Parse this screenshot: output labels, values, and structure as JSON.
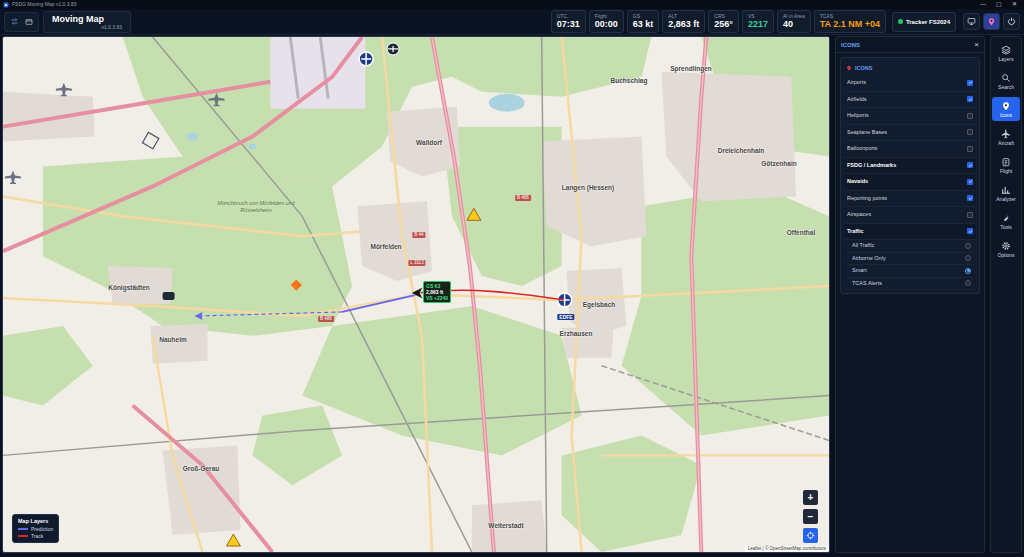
{
  "window": {
    "title": "FSDG Moving Map v1.0.3.83",
    "controls": [
      "—",
      "▢",
      "✕"
    ]
  },
  "header": {
    "title": "Moving Map",
    "version": "v1.0.3.83",
    "stats": [
      {
        "label": "UTC",
        "value": "07:31",
        "color": "#ffffff"
      },
      {
        "label": "Flight",
        "value": "00:00",
        "color": "#ffffff"
      },
      {
        "label": "GS",
        "value": "63 kt",
        "color": "#ffffff"
      },
      {
        "label": "ALT",
        "value": "2,863 ft",
        "color": "#ffffff"
      },
      {
        "label": "CRS",
        "value": "256°",
        "color": "#ffffff"
      },
      {
        "label": "VS",
        "value": "2217",
        "color": "#34d399"
      },
      {
        "label": "AI in Area",
        "value": "40",
        "color": "#ffffff"
      },
      {
        "label": "TCAS",
        "value": "TA 2.1 NM +04",
        "color": "#f59e0b"
      }
    ],
    "tracker": {
      "label": "Tracker FS2024",
      "connected": true
    },
    "buttons": [
      {
        "kind": "monitor",
        "selected": false
      },
      {
        "kind": "pin",
        "selected": true
      },
      {
        "kind": "power",
        "selected": false
      }
    ]
  },
  "nav": [
    {
      "label": "Layers",
      "kind": "layers",
      "selected": false
    },
    {
      "label": "Search",
      "kind": "search",
      "selected": false
    },
    {
      "label": "Icons",
      "kind": "pin",
      "selected": true
    },
    {
      "label": "Aircraft",
      "kind": "plane",
      "selected": false
    },
    {
      "label": "Flight",
      "kind": "clipboard",
      "selected": false
    },
    {
      "label": "Analyzer",
      "kind": "chart",
      "selected": false
    },
    {
      "label": "Tools",
      "kind": "wrench",
      "selected": false
    },
    {
      "label": "Options",
      "kind": "gear",
      "selected": false
    }
  ],
  "panel": {
    "title": "ICONS",
    "close": "×",
    "section": "ICONS",
    "items": [
      {
        "kind": "checkbox",
        "label": "Airports",
        "checked": true
      },
      {
        "kind": "checkbox",
        "label": "Airfields",
        "checked": true
      },
      {
        "kind": "checkbox",
        "label": "Heliports",
        "checked": false
      },
      {
        "kind": "checkbox",
        "label": "Seaplane Bases",
        "checked": false
      },
      {
        "kind": "checkbox",
        "label": "Balloonports",
        "checked": false
      },
      {
        "kind": "group",
        "label": "FSDG / Landmarks",
        "checked": true
      },
      {
        "kind": "group",
        "label": "Navaids",
        "checked": true
      },
      {
        "kind": "checkbox",
        "label": "Reporting points",
        "checked": true
      },
      {
        "kind": "checkbox",
        "label": "Airspaces",
        "checked": false
      },
      {
        "kind": "group",
        "label": "Traffic",
        "checked": true
      },
      {
        "kind": "radio",
        "label": "All Traffic",
        "selected": false
      },
      {
        "kind": "radio",
        "label": "Airborne Only",
        "selected": false
      },
      {
        "kind": "radio",
        "label": "Smart",
        "selected": true
      },
      {
        "kind": "radio",
        "label": "TCAS Alerts",
        "selected": false
      }
    ]
  },
  "map": {
    "places": [
      "Walldorf",
      "Mörfelden",
      "Langen (Hessen)",
      "Egelsbach",
      "Erzhausen",
      "Nauheim",
      "Königstädten",
      "Groß-Gerau",
      "Buchschlag",
      "Sprendlingen",
      "Dreieichenhain",
      "Götzenhain",
      "Offenthal",
      "Mönchbruch von Mörfelden und Rüsselsheim",
      "Weiterstadt"
    ],
    "roads": [
      "B 44",
      "L 3113",
      "B 486",
      "B 486"
    ],
    "airports": [
      "EDFE"
    ],
    "aircraft": {
      "lines": [
        "GS 63",
        "2,863 ft",
        "VS +2240"
      ]
    },
    "legend": {
      "title": "Map Layers",
      "items": [
        {
          "label": "Prediction",
          "color": "#6366f1"
        },
        {
          "label": "Track",
          "color": "#dc2626"
        }
      ]
    },
    "zoom": [
      "+",
      "−"
    ],
    "attribution": "Leaflet | © OpenStreetMap contributors"
  }
}
